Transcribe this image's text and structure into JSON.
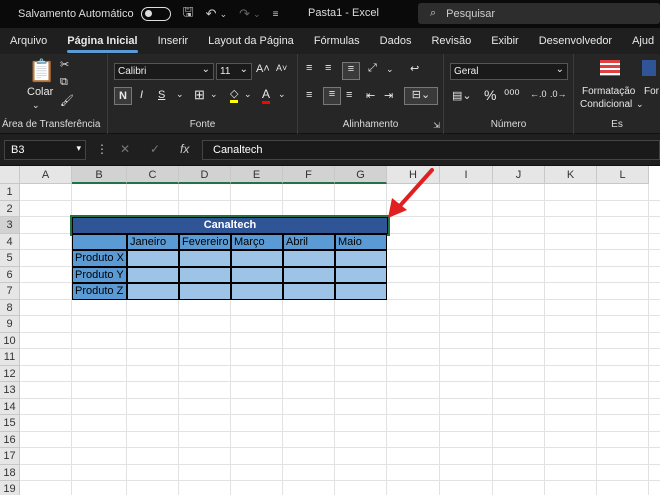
{
  "titlebar": {
    "autosave": "Salvamento Automático",
    "title": "Pasta1  -  Excel",
    "search_placeholder": "Pesquisar"
  },
  "tabs": [
    "Arquivo",
    "Página Inicial",
    "Inserir",
    "Layout da Página",
    "Fórmulas",
    "Dados",
    "Revisão",
    "Exibir",
    "Desenvolvedor",
    "Ajud"
  ],
  "ribbon": {
    "paste_label": "Colar",
    "clipboard_group": "Área de Transferência",
    "font_name": "Calibri",
    "font_size": "11",
    "font_group": "Fonte",
    "bold": "N",
    "italic": "I",
    "underline": "S",
    "alignment_group": "Alinhamento",
    "number_format": "Geral",
    "number_group": "Número",
    "cond_format_1": "Formatação",
    "cond_format_2": "Condicional",
    "styles_cut": "Es",
    "format_cut": "For"
  },
  "formula": {
    "namebox": "B3",
    "fx": "fx",
    "content": "Canaltech"
  },
  "columns": [
    "A",
    "B",
    "C",
    "D",
    "E",
    "F",
    "G",
    "H",
    "I",
    "J",
    "K",
    "L"
  ],
  "rows": [
    "1",
    "2",
    "3",
    "4",
    "5",
    "6",
    "7",
    "8",
    "9",
    "10",
    "11",
    "12",
    "13",
    "14",
    "15",
    "16",
    "17",
    "18",
    "19"
  ],
  "table": {
    "title": "Canaltech",
    "months": [
      "Janeiro",
      "Fevereiro",
      "Março",
      "Abril",
      "Maio"
    ],
    "products": [
      "Produto X",
      "Produto Y",
      "Produto Z"
    ]
  },
  "colors": {
    "header_blue": "#2f5597",
    "cell_blue": "#9dc3e6",
    "label_blue": "#5b9bd5",
    "selection_green": "#217346",
    "arrow_red": "#e02020"
  }
}
